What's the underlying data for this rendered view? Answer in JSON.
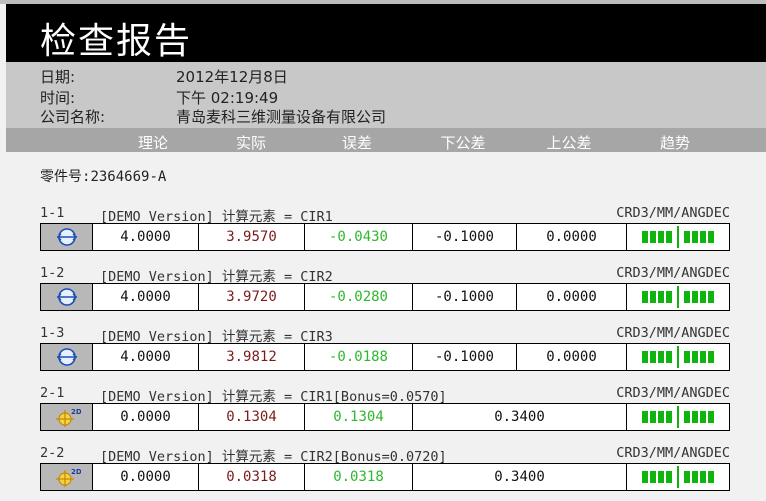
{
  "report": {
    "title": "检查报告"
  },
  "info": {
    "date_label": "日期:",
    "date_value": "2012年12月8日",
    "time_label": "时间:",
    "time_value": "下午 02:19:49",
    "company_label": "公司名称:",
    "company_value": "青岛麦科三维测量设备有限公司"
  },
  "columns": [
    "理论",
    "实际",
    "误差",
    "下公差",
    "上公差",
    "趋势"
  ],
  "part": {
    "label": "零件号:",
    "value": "2364669-A"
  },
  "features": [
    {
      "id": "1-1",
      "desc": "[DEMO Version]  计算元素 =  CIR1",
      "unit": "CRD3/MM/ANGDEC",
      "icon": "circle-diameter-icon",
      "nominal": "4.0000",
      "actual": "3.9570",
      "deviation": "-0.0430",
      "lower_tol": "-0.1000",
      "upper_tol": "0.0000",
      "trend": {
        "left_blocks": 4,
        "right_blocks": 4
      }
    },
    {
      "id": "1-2",
      "desc": "[DEMO Version]  计算元素 =  CIR2",
      "unit": "CRD3/MM/ANGDEC",
      "icon": "circle-diameter-icon",
      "nominal": "4.0000",
      "actual": "3.9720",
      "deviation": "-0.0280",
      "lower_tol": "-0.1000",
      "upper_tol": "0.0000",
      "trend": {
        "left_blocks": 4,
        "right_blocks": 4
      }
    },
    {
      "id": "1-3",
      "desc": "[DEMO Version]  计算元素 =  CIR3",
      "unit": "CRD3/MM/ANGDEC",
      "icon": "circle-diameter-icon",
      "nominal": "4.0000",
      "actual": "3.9812",
      "deviation": "-0.0188",
      "lower_tol": "-0.1000",
      "upper_tol": "0.0000",
      "trend": {
        "left_blocks": 4,
        "right_blocks": 4
      }
    },
    {
      "id": "2-1",
      "desc": "[DEMO Version]  计算元素 =  CIR1[Bonus=0.0570]",
      "unit": "CRD3/MM/ANGDEC",
      "icon": "position-2d-icon",
      "nominal": "0.0000",
      "actual": "0.1304",
      "deviation": "0.1304",
      "tolerance": "0.3400",
      "trend": {
        "left_blocks": 4,
        "right_blocks": 4
      }
    },
    {
      "id": "2-2",
      "desc": "[DEMO Version]  计算元素 =  CIR2[Bonus=0.0720]",
      "unit": "CRD3/MM/ANGDEC",
      "icon": "position-2d-icon",
      "nominal": "0.0000",
      "actual": "0.0318",
      "deviation": "0.0318",
      "tolerance": "0.3400",
      "trend": {
        "left_blocks": 4,
        "right_blocks": 4
      }
    }
  ]
}
